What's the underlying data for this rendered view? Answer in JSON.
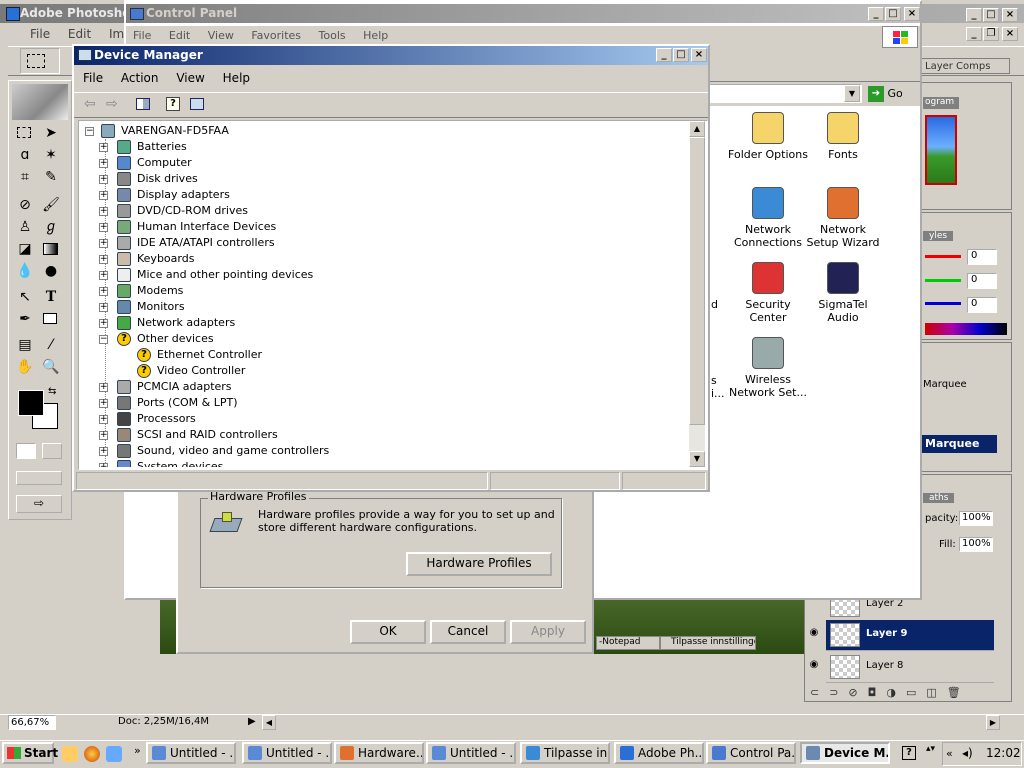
{
  "photoshop": {
    "title": "Adobe Photoshop",
    "menu": [
      "File",
      "Edit",
      "Image"
    ],
    "status": {
      "zoom": "66,67%",
      "doc": "Doc: 2,25M/16,4M"
    },
    "palette_tab": "Layer Comps",
    "histogram_tab": "ogram",
    "styles_tab": "yles",
    "color_values": [
      "0",
      "0",
      "0"
    ],
    "history_items": [
      "Marquee",
      "Marquee"
    ],
    "paths_tab": "aths",
    "opacity_label": "pacity:",
    "opacity_value": "100%",
    "fill_label": "Fill:",
    "fill_value": "100%",
    "layers": [
      {
        "name": "Layer 2",
        "selected": false,
        "visible": false
      },
      {
        "name": "Layer 9",
        "selected": true,
        "visible": true
      },
      {
        "name": "Layer 8",
        "selected": false,
        "visible": true
      }
    ]
  },
  "control_panel": {
    "title": "Control Panel",
    "menu": [
      "File",
      "Edit",
      "View",
      "Favorites",
      "Tools",
      "Help"
    ],
    "go_label": "Go",
    "items": [
      {
        "label": "Folder Options",
        "icon": "folder-options-icon"
      },
      {
        "label": "Fonts",
        "icon": "fonts-icon"
      },
      {
        "label": "Network Connections",
        "icon": "network-connections-icon"
      },
      {
        "label": "Network Setup Wizard",
        "icon": "network-setup-icon"
      },
      {
        "label": "Security Center",
        "icon": "security-center-icon"
      },
      {
        "label": "SigmaTel Audio",
        "icon": "sigmatel-icon"
      },
      {
        "label": "Wireless Network Set...",
        "icon": "wireless-icon"
      }
    ],
    "partial_labels": [
      "d",
      "s",
      "i..."
    ]
  },
  "system_props": {
    "group_title": "Hardware Profiles",
    "text": "Hardware profiles provide a way for you to set up and store different hardware configurations.",
    "hw_button": "Hardware Profiles",
    "ok": "OK",
    "cancel": "Cancel",
    "apply": "Apply"
  },
  "device_manager": {
    "title": "Device Manager",
    "menu": [
      "File",
      "Action",
      "View",
      "Help"
    ],
    "root": "VARENGAN-FD5FAA",
    "nodes": [
      {
        "label": "Batteries",
        "expanded": false
      },
      {
        "label": "Computer",
        "expanded": false
      },
      {
        "label": "Disk drives",
        "expanded": false
      },
      {
        "label": "Display adapters",
        "expanded": false
      },
      {
        "label": "DVD/CD-ROM drives",
        "expanded": false
      },
      {
        "label": "Human Interface Devices",
        "expanded": false
      },
      {
        "label": "IDE ATA/ATAPI controllers",
        "expanded": false
      },
      {
        "label": "Keyboards",
        "expanded": false
      },
      {
        "label": "Mice and other pointing devices",
        "expanded": false
      },
      {
        "label": "Modems",
        "expanded": false
      },
      {
        "label": "Monitors",
        "expanded": false
      },
      {
        "label": "Network adapters",
        "expanded": false
      },
      {
        "label": "Other devices",
        "expanded": true
      },
      {
        "label": "Ethernet Controller",
        "child": true
      },
      {
        "label": "Video Controller",
        "child": true
      },
      {
        "label": "PCMCIA adapters",
        "expanded": false
      },
      {
        "label": "Ports (COM & LPT)",
        "expanded": false
      },
      {
        "label": "Processors",
        "expanded": false
      },
      {
        "label": "SCSI and RAID controllers",
        "expanded": false
      },
      {
        "label": "Sound, video and game controllers",
        "expanded": false
      },
      {
        "label": "System devices",
        "expanded": false
      }
    ]
  },
  "background_windows": {
    "notepad": "-Notepad",
    "tilpasse": "Tilpasse innstillingene..."
  },
  "taskbar": {
    "start": "Start",
    "tasks": [
      {
        "label": "Untitled - ...",
        "active": false
      },
      {
        "label": "Untitled - ...",
        "active": false
      },
      {
        "label": "Hardware...",
        "active": false
      },
      {
        "label": "Untitled - ...",
        "active": false
      },
      {
        "label": "Tilpasse in...",
        "active": false
      },
      {
        "label": "Adobe Ph...",
        "active": false
      },
      {
        "label": "Control Pa...",
        "active": false
      },
      {
        "label": "Device M...",
        "active": true
      }
    ],
    "clock": "12:02"
  },
  "colors": {
    "selection": "#0a246a",
    "title_active": "#0a246a",
    "face": "#d4d0c8"
  }
}
